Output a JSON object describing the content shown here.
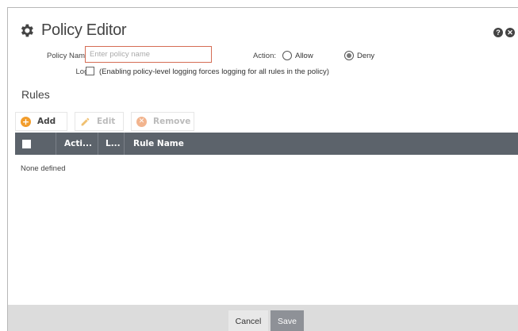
{
  "header": {
    "title": "Policy Editor",
    "help_glyph": "?",
    "close_glyph": "✕"
  },
  "form": {
    "policy_name_label": "Policy Name:",
    "policy_name_value": "",
    "policy_name_placeholder": "Enter policy name",
    "action_label": "Action:",
    "action_options": [
      {
        "label": "Allow",
        "selected": false
      },
      {
        "label": "Deny",
        "selected": true
      }
    ],
    "log_label": "Log:",
    "log_checked": false,
    "log_note": "(Enabling policy-level logging forces logging for all rules in the policy)"
  },
  "rules": {
    "heading": "Rules",
    "toolbar": {
      "add_label": "Add",
      "edit_label": "Edit",
      "remove_label": "Remove"
    },
    "columns": [
      "Acti...",
      "L...",
      "Rule Name"
    ],
    "empty_text": "None defined"
  },
  "footer": {
    "cancel_label": "Cancel",
    "save_label": "Save"
  },
  "colors": {
    "accent_orange": "#f29d2c",
    "input_border": "#d56d55",
    "table_header": "#5c636b",
    "footer_bg": "#dcdcdc",
    "save_button": "#8e9197"
  },
  "icons": [
    "gear-icon",
    "help-icon",
    "close-icon",
    "plus-icon",
    "pencil-icon",
    "remove-icon"
  ]
}
